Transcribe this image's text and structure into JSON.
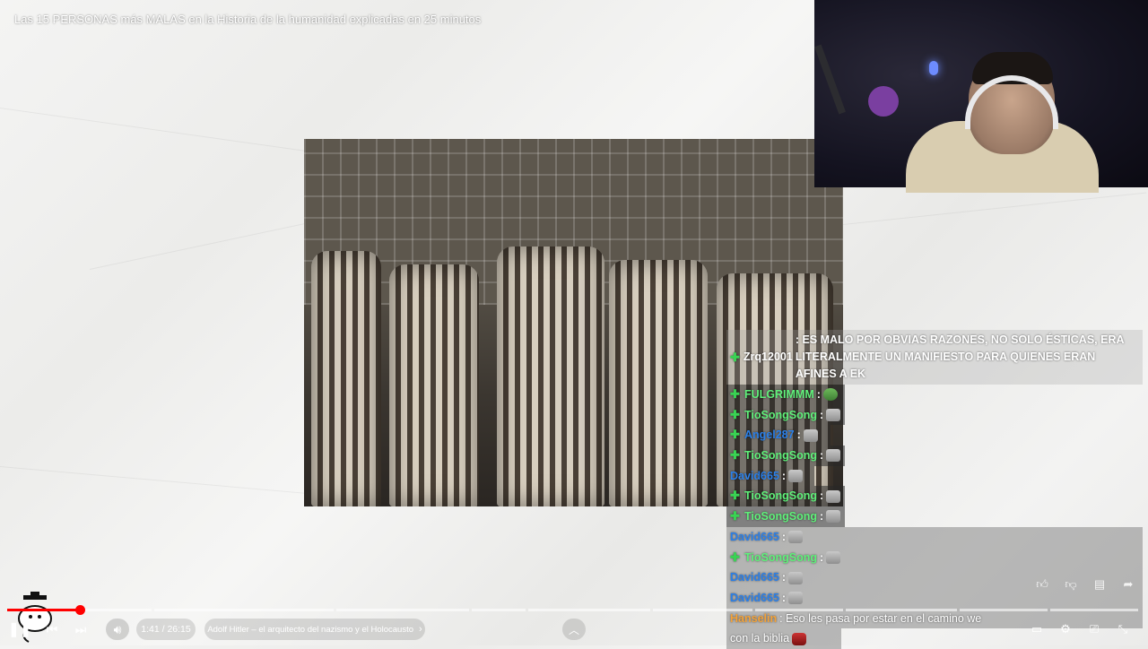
{
  "video": {
    "title": "Las 15 PERSONAS más MALAS en la Historia de la humanidad explicadas en 25 minutos"
  },
  "chat": {
    "messages": [
      {
        "user": "Zrq12001",
        "badge": true,
        "color": "#ffffff",
        "text": ": ES MALO POR OBVIAS RAZONES, NO SOLO ÉSTICAS, ERA LITERALMENTE UN MANIFIESTO PARA QUIENES ERAN AFINES A EK"
      },
      {
        "user": "FULGRIMMM",
        "badge": true,
        "color": "#5ff07a",
        "text": ":",
        "emote": "frog"
      },
      {
        "user": "TioSongSong",
        "badge": true,
        "color": "#5ff07a",
        "text": ":",
        "emote": "cat"
      },
      {
        "user": "Angel287",
        "badge": true,
        "color": "#2a7fe8",
        "text": ":",
        "emote": "cat"
      },
      {
        "user": "TioSongSong",
        "badge": true,
        "color": "#5ff07a",
        "text": ":",
        "emote": "cat"
      },
      {
        "user": "David665",
        "badge": false,
        "color": "#2a7fe8",
        "text": ":",
        "emote": "cat"
      },
      {
        "user": "TioSongSong",
        "badge": true,
        "color": "#5ff07a",
        "text": ":",
        "emote": "cat"
      },
      {
        "user": "TioSongSong",
        "badge": true,
        "color": "#5ff07a",
        "text": ":",
        "emote": "cat"
      },
      {
        "user": "David665",
        "badge": false,
        "color": "#2a7fe8",
        "text": ":",
        "emote": "cat"
      },
      {
        "user": "TioSongSong",
        "badge": true,
        "color": "#5ff07a",
        "text": ":",
        "emote": "cat"
      },
      {
        "user": "David665",
        "badge": false,
        "color": "#2a7fe8",
        "text": ":",
        "emote": "cat"
      },
      {
        "user": "David665",
        "badge": false,
        "color": "#2a7fe8",
        "text": ":",
        "emote": "cat"
      },
      {
        "user": "Hanselin",
        "badge": false,
        "color": "#f2a23a",
        "text": ": Eso les pasa por estar en el camino we"
      },
      {
        "user": "",
        "badge": false,
        "color": "#ffffff",
        "text": "con la biblia",
        "emote": "red"
      }
    ]
  },
  "player": {
    "time_display": "1:41 / 26:15",
    "chapter_title": "Adolf Hitler – el arquitecto del nazismo y el Holocausto",
    "chapter_chevron": "›",
    "progress_fraction": 0.064,
    "play_icon": "pause-icon",
    "prev_icon": "previous-icon",
    "next_icon": "next-icon",
    "volume_icon": "volume-icon",
    "expand_icon": "chevron-up-icon"
  },
  "actions": {
    "like_icon": "thumbs-up-icon",
    "dislike_icon": "thumbs-down-icon",
    "comments_icon": "comment-icon",
    "share_icon": "share-icon"
  },
  "right_controls": {
    "subtitles_icon": "subtitles-icon",
    "settings_icon": "gear-icon",
    "cast_icon": "cast-icon",
    "exit_fullscreen_icon": "exit-fullscreen-icon"
  }
}
